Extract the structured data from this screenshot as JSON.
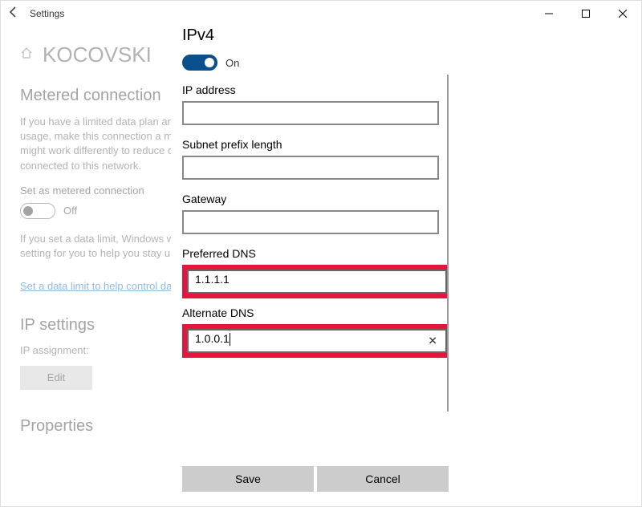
{
  "titlebar": {
    "title": "Settings"
  },
  "page": {
    "network_name": "KOCOVSKI",
    "metered_heading": "Metered connection",
    "metered_body": "If you have a limited data plan and want more control over data usage, make this connection a metered network. Some apps might work differently to reduce data usage when you're connected to this network.",
    "metered_toggle_label": "Set as metered connection",
    "metered_toggle_state": "Off",
    "metered_note": "If you set a data limit, Windows will set the metered connection setting for you to help you stay under your limit.",
    "data_limit_link": "Set a data limit to help control data usage on this network",
    "ip_settings_heading": "IP settings",
    "ip_assignment_label": "IP assignment:",
    "edit_label": "Edit",
    "properties_heading": "Properties"
  },
  "modal": {
    "heading": "IPv4",
    "toggle_state": "On",
    "fields": {
      "ip_label": "IP address",
      "ip_value": "",
      "subnet_label": "Subnet prefix length",
      "subnet_value": "",
      "gateway_label": "Gateway",
      "gateway_value": "",
      "pref_dns_label": "Preferred DNS",
      "pref_dns_value": "1.1.1.1",
      "alt_dns_label": "Alternate DNS",
      "alt_dns_value": "1.0.0.1"
    },
    "save_label": "Save",
    "cancel_label": "Cancel"
  }
}
